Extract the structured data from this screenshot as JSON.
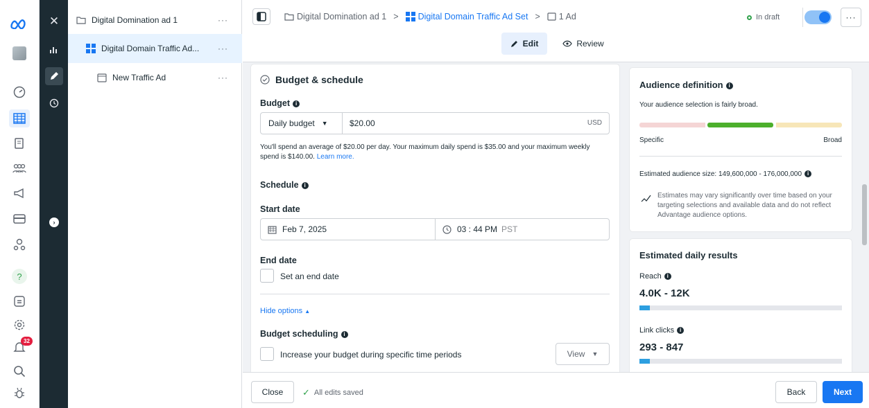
{
  "tree": {
    "campaign": "Digital Domination ad 1",
    "adset": "Digital Domain Traffic Ad...",
    "ad": "New Traffic Ad",
    "dots": "···"
  },
  "nav": {
    "notif_count": "32"
  },
  "breadcrumb": {
    "campaign": "Digital Domination ad 1",
    "sep1": ">",
    "adset": "Digital Domain Traffic Ad Set",
    "sep2": ">",
    "ad": "1 Ad"
  },
  "header": {
    "status": "In draft",
    "more": "···",
    "edit": "Edit",
    "review": "Review"
  },
  "budget": {
    "section_title": "Budget & schedule",
    "budget_label": "Budget",
    "budget_type": "Daily budget",
    "amount": "$20.00",
    "currency": "USD",
    "note": "You'll spend an average of $20.00 per day. Your maximum daily spend is $35.00 and your maximum weekly spend is $140.00.",
    "learn_more": "Learn more.",
    "schedule_label": "Schedule",
    "start_date_label": "Start date",
    "start_date": "Feb 7, 2025",
    "start_time": "03 : 44 PM",
    "timezone": "PST",
    "end_date_label": "End date",
    "end_date_option": "Set an end date",
    "hide_options": "Hide options",
    "budget_scheduling_label": "Budget scheduling",
    "budget_scheduling_option": "Increase your budget during specific time periods",
    "view": "View"
  },
  "audience": {
    "title": "Audience definition",
    "desc": "Your audience selection is fairly broad.",
    "specific": "Specific",
    "broad": "Broad",
    "size": "Estimated audience size: 149,600,000 - 176,000,000",
    "estimate_note": "Estimates may vary significantly over time based on your targeting selections and available data and do not reflect Advantage audience options.",
    "colors": {
      "specific": "#f5d5d5",
      "current": "#4caf2c",
      "broad": "#f7e6b8"
    }
  },
  "results": {
    "title": "Estimated daily results",
    "reach_label": "Reach",
    "reach_value": "4.0K - 12K",
    "reach_fraction": 0.05,
    "clicks_label": "Link clicks",
    "clicks_value": "293 - 847",
    "clicks_fraction": 0.05
  },
  "footer": {
    "close": "Close",
    "saved": "All edits saved",
    "back": "Back",
    "next": "Next"
  },
  "colors": {
    "accent": "#1877f2",
    "dark_rail": "#1c2b33",
    "green": "#31a24c"
  }
}
